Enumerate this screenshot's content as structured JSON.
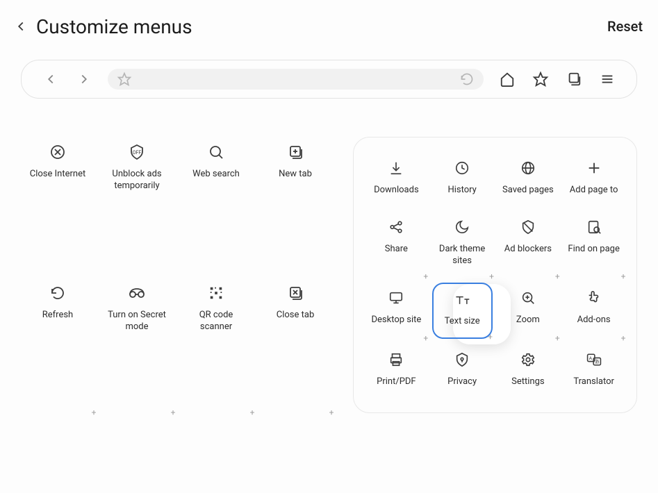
{
  "header": {
    "title": "Customize menus",
    "reset": "Reset"
  },
  "left_items": [
    {
      "id": "close-internet",
      "label": "Close Internet",
      "plus": false
    },
    {
      "id": "unblock-ads",
      "label": "Unblock ads temporarily",
      "plus": false
    },
    {
      "id": "web-search",
      "label": "Web search",
      "plus": false
    },
    {
      "id": "new-tab",
      "label": "New tab",
      "plus": false
    },
    {
      "id": "refresh",
      "label": "Refresh",
      "plus": true
    },
    {
      "id": "secret-mode",
      "label": "Turn on Secret mode",
      "plus": true
    },
    {
      "id": "qr-scanner",
      "label": "QR code scanner",
      "plus": true
    },
    {
      "id": "close-tab",
      "label": "Close tab",
      "plus": true
    }
  ],
  "right_items": [
    {
      "id": "downloads",
      "label": "Downloads",
      "plus": false
    },
    {
      "id": "history",
      "label": "History",
      "plus": false
    },
    {
      "id": "saved-pages",
      "label": "Saved pages",
      "plus": false
    },
    {
      "id": "add-page-to",
      "label": "Add page to",
      "plus": false
    },
    {
      "id": "share",
      "label": "Share",
      "plus": true
    },
    {
      "id": "dark-theme",
      "label": "Dark theme sites",
      "plus": true
    },
    {
      "id": "ad-blockers",
      "label": "Ad blockers",
      "plus": true
    },
    {
      "id": "find-on-page",
      "label": "Find on page",
      "plus": true
    },
    {
      "id": "desktop-site",
      "label": "Desktop site",
      "plus": true,
      "selected": false
    },
    {
      "id": "text-size",
      "label": "Text size",
      "plus": true,
      "selected": true,
      "popup": true
    },
    {
      "id": "zoom",
      "label": "Zoom",
      "plus": true
    },
    {
      "id": "add-ons",
      "label": "Add-ons",
      "plus": true
    },
    {
      "id": "print-pdf",
      "label": "Print/PDF",
      "plus": false
    },
    {
      "id": "privacy",
      "label": "Privacy",
      "plus": false
    },
    {
      "id": "settings",
      "label": "Settings",
      "plus": false
    },
    {
      "id": "translator",
      "label": "Translator",
      "plus": false
    }
  ]
}
